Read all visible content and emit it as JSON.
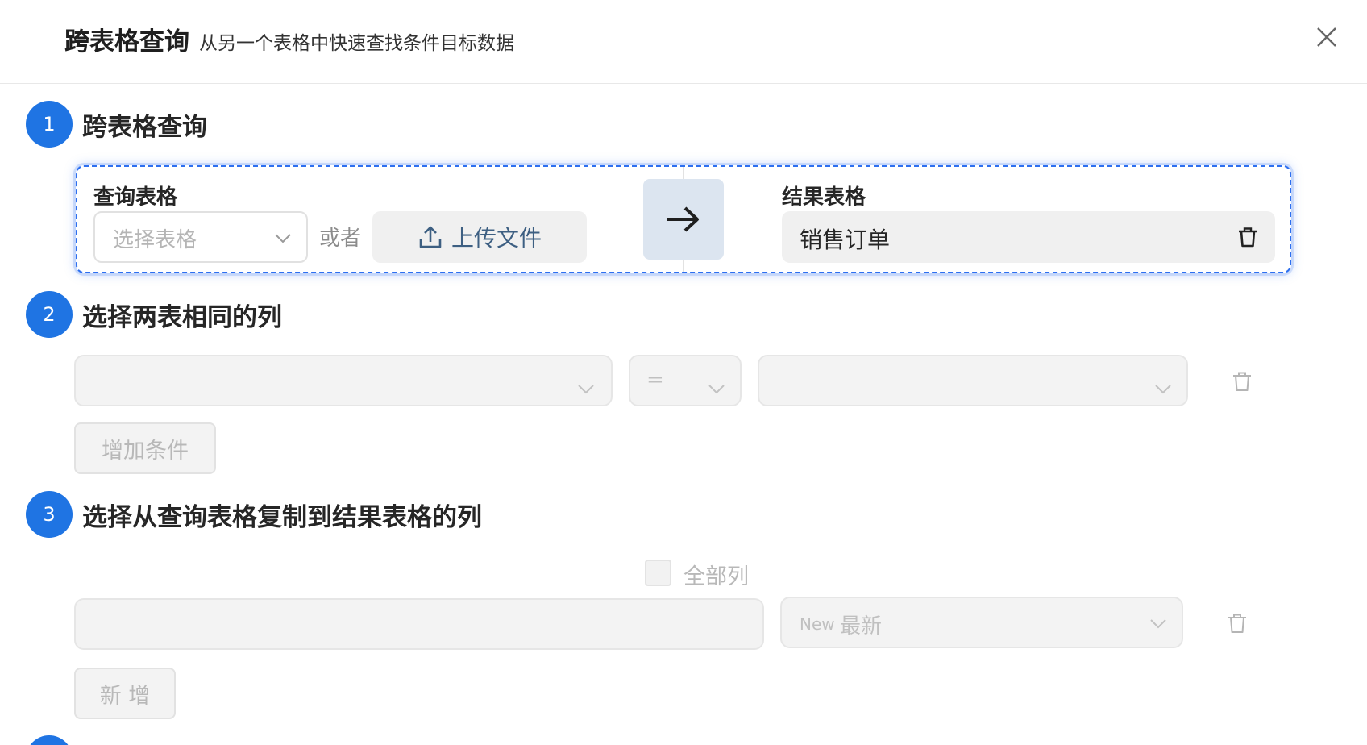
{
  "header": {
    "title": "跨表格查询",
    "subtitle": "从另一个表格中快速查找条件目标数据",
    "close_icon": "close-icon"
  },
  "step1": {
    "number": "1",
    "title": "跨表格查询",
    "query_label": "查询表格",
    "select_placeholder": "选择表格",
    "or_text": "或者",
    "upload_label": "上传文件",
    "result_label": "结果表格",
    "result_value": "销售订单"
  },
  "step2": {
    "number": "2",
    "title": "选择两表相同的列",
    "operator": "=",
    "add_condition": "增加条件"
  },
  "step3": {
    "number": "3",
    "title": "选择从查询表格复制到结果表格的列",
    "all_columns": "全部列",
    "mode_badge": "New",
    "mode_value": "最新",
    "add_label": "新 增"
  },
  "colors": {
    "accent": "#1f74e3",
    "dashed_border": "#2d6ff0",
    "arrow_bg": "#dce5f0"
  }
}
